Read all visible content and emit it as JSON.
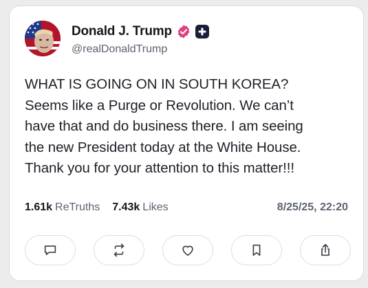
{
  "post": {
    "display_name": "Donald J. Trump",
    "handle": "@realDonaldTrump",
    "lines": [
      "WHAT IS GOING ON IN SOUTH KOREA?",
      "Seems like a Purge or Revolution. We can’t",
      "have that and do business there. I am seeing",
      "the new President today at the White House.",
      "Thank you for your attention to this matter!!!"
    ]
  },
  "stats": {
    "retruths_count": "1.61k",
    "retruths_label": "ReTruths",
    "likes_count": "7.43k",
    "likes_label": "Likes",
    "timestamp": "8/25/25, 22:20"
  },
  "actions": [
    "reply-icon",
    "retruth-icon",
    "heart-icon",
    "bookmark-icon",
    "share-icon"
  ],
  "colors": {
    "verified_badge": "#e0407e",
    "plus_badge": "#1b1e3a",
    "text": "#1d2027",
    "muted": "#5b6270"
  }
}
